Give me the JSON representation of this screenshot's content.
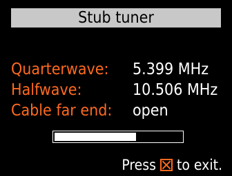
{
  "header": {
    "title": "Stub tuner"
  },
  "rows": [
    {
      "label": "Quarterwave:",
      "value": "5.399 MHz"
    },
    {
      "label": "Halfwave:",
      "value": "10.506 MHz"
    },
    {
      "label": "Cable far end:",
      "value": "open"
    }
  ],
  "progress": {
    "fraction": 0.64
  },
  "footer": {
    "prefix": "Press",
    "icon": "x-button-icon",
    "suffix": "to exit."
  },
  "colors": {
    "label": "#ff6a20",
    "value": "#ffffff",
    "title_bg": "#c8c8c8",
    "background": "#000000"
  }
}
